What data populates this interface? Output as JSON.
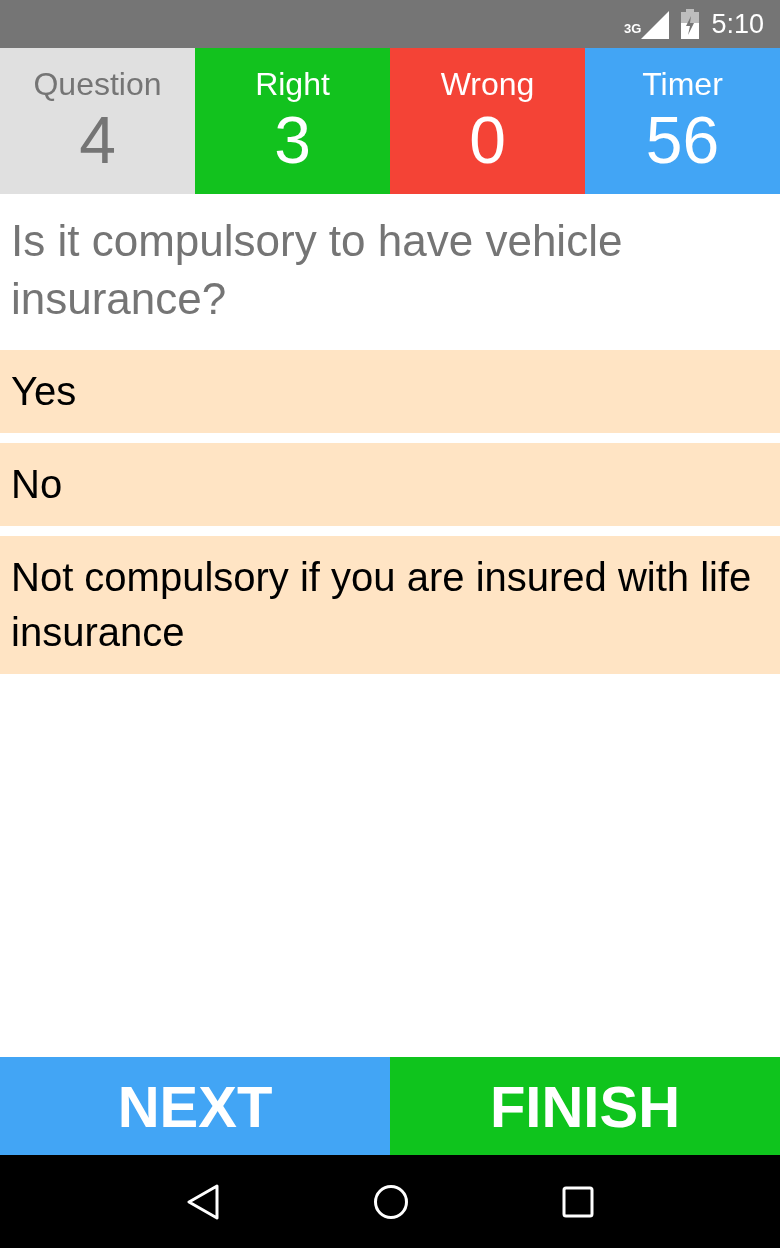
{
  "status_bar": {
    "network": "3G",
    "time": "5:10"
  },
  "scoreboard": [
    {
      "kind": "question",
      "label": "Question",
      "value": "4"
    },
    {
      "kind": "right",
      "label": "Right",
      "value": "3"
    },
    {
      "kind": "wrong",
      "label": "Wrong",
      "value": "0"
    },
    {
      "kind": "timer",
      "label": "Timer",
      "value": "56"
    }
  ],
  "question": "Is it compulsory to have vehicle insurance?",
  "answers": [
    "Yes",
    "No",
    "Not compulsory if you are insured with life insurance"
  ],
  "buttons": [
    {
      "kind": "next",
      "label": "NEXT"
    },
    {
      "kind": "finish",
      "label": "FINISH"
    }
  ]
}
